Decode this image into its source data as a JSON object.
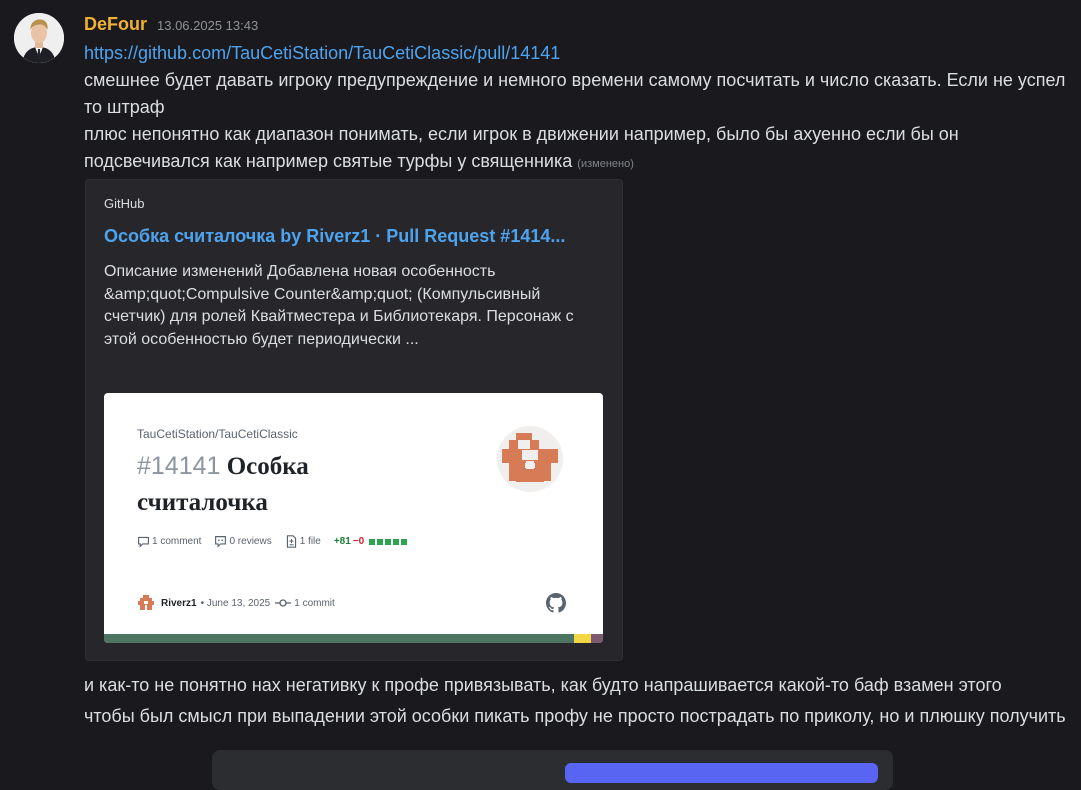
{
  "message": {
    "author": "DeFour",
    "author_color": "#f0b232",
    "timestamp": "13.06.2025 13:43",
    "link": "https://github.com/TauCetiStation/TauCetiClassic/pull/14141",
    "paragraph_1": "смешнее будет давать игроку предупреждение и немного времени самому посчитать и число сказать. Если не успел то штраф",
    "paragraph_2": "плюс непонятно как диапазон понимать, если игрок в движении например, было бы ахуенно если бы он подсвечивался как например святые турфы у священника",
    "edited_label": "(изменено)",
    "paragraph_3": "и как-то не понятно нах негативку к профе привязывать, как будто напрашивается какой-то баф взамен этого",
    "paragraph_4": "чтобы был смысл при выпадении этой особки пикать профу не просто пострадать по приколу, но и плюшку получить"
  },
  "embed": {
    "provider": "GitHub",
    "title": "Особка считалочка  by Riverz1 · Pull Request #1414...",
    "description": "Описание изменений Добавлена новая особенность &amp;quot;Compulsive Counter&amp;quot; (Компульсивный счетчик) для ролей Квайтместера и Библиотекаря. Персонаж с этой особенностью будет периодически ...",
    "link_color": "#4ea3ef",
    "card": {
      "repo": "TauCetiStation/TauCetiClassic",
      "pr_number": "#14141",
      "pr_title": "Особка считалочка",
      "comments": "1 comment",
      "reviews": "0 reviews",
      "files": "1 file",
      "additions": "+81",
      "deletions": "−0",
      "author": "Riverz1",
      "date_info": "• June 13, 2025",
      "commits": "1 commit",
      "icons": [
        "comment-icon",
        "review-icon",
        "file-diff-icon",
        "commit-icon",
        "github-icon"
      ]
    }
  }
}
